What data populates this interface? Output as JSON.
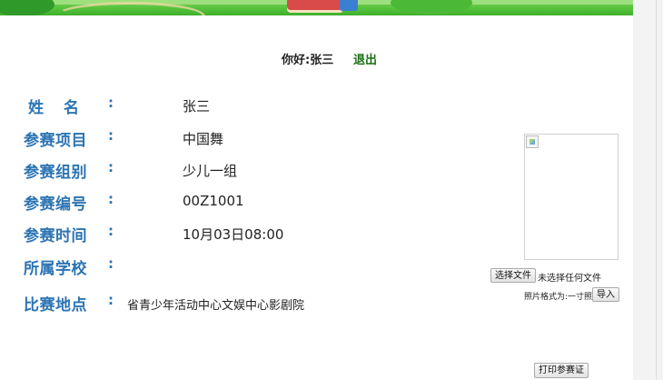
{
  "header": {
    "greeting": "你好:张三",
    "logout_label": "退出"
  },
  "fields": [
    {
      "label": "姓名",
      "colon": ":",
      "value": "张三"
    },
    {
      "label": "参赛项目",
      "colon": ":",
      "value": "中国舞"
    },
    {
      "label": "参赛组别",
      "colon": ":",
      "value": "少儿一组"
    },
    {
      "label": "参赛编号",
      "colon": ":",
      "value": "00Z1001"
    },
    {
      "label": "参赛时间",
      "colon": ":",
      "value": "10月03日08:00"
    },
    {
      "label": "所属学校",
      "colon": ":",
      "value": ""
    },
    {
      "label": "比赛地点",
      "colon": ":",
      "value": "省青少年活动中心文娱中心影剧院"
    }
  ],
  "photo": {
    "choose_file_label": "选择文件",
    "no_file_text": "未选择任何文件",
    "format_hint": "照片格式为:一寸照",
    "import_label": "导入"
  },
  "print_label": "打印参赛证",
  "colors": {
    "label": "#2c74b3",
    "logout": "#1b6e12",
    "banner": "#56c13b"
  }
}
